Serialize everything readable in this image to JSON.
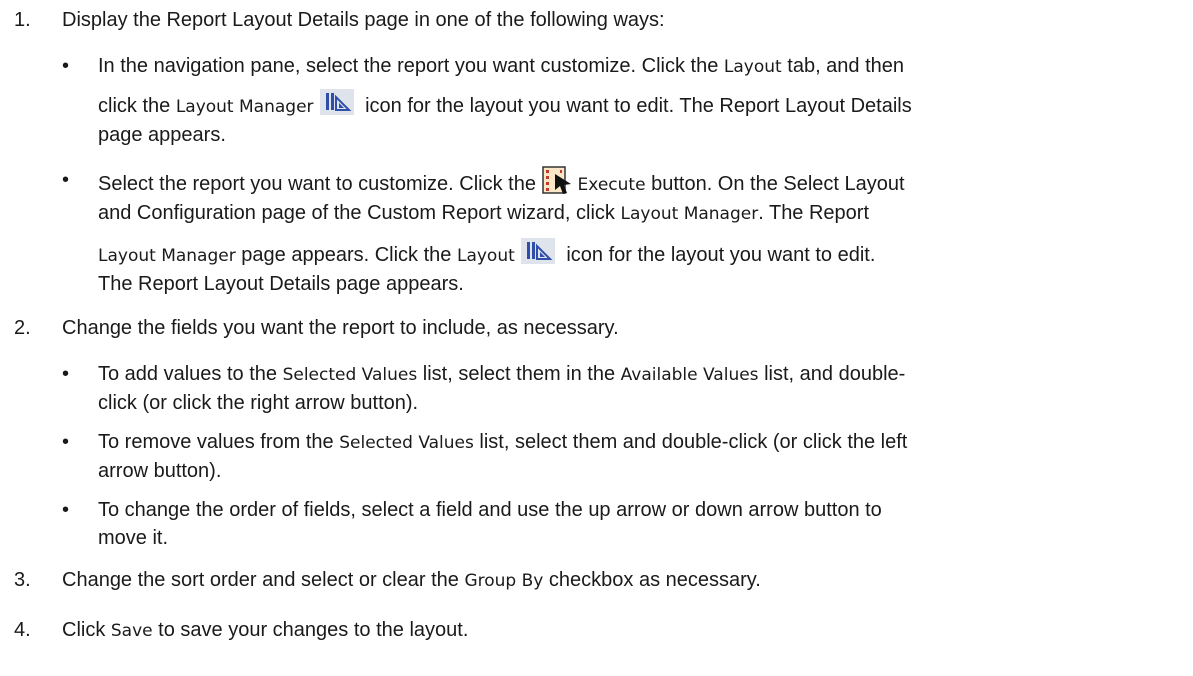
{
  "steps": [
    {
      "number": "1.",
      "text": "Display the Report Layout Details page in one of the following ways:",
      "bullets": [
        {
          "p1": "In the navigation pane, select the report you want customize. Click the ",
          "ui1": "Layout",
          "p2": " tab, and then",
          "p3": "click the ",
          "ui2": "Layout Manager",
          "icon": "layout-manager-icon",
          "p4": " icon for the layout you want to edit. The Report Layout Details",
          "p5": "page appears."
        },
        {
          "p1": "Select the report you want to customize. Click the ",
          "icon": "execute-icon",
          "ui1": "Execute",
          "p2": " button. On the Select Layout",
          "p3": "and Configuration page of the Custom Report wizard, click ",
          "ui2": "Layout Manager",
          "p4": ". The Report",
          "ui3": "Layout Manager",
          "p5": " page appears. Click the ",
          "ui4": "Layout",
          "icon2": "layout-icon",
          "p6": " icon for the layout you want to edit.",
          "p7": "The Report Layout Details page appears."
        }
      ]
    },
    {
      "number": "2.",
      "text": "Change the fields you want the report to include, as necessary.",
      "bullets": [
        {
          "p1": "To add values to the ",
          "ui1": "Selected Values",
          "p2": " list, select them in the ",
          "ui2": "Available Values",
          "p3": " list, and double-",
          "p4": "click (or click the right arrow button)."
        },
        {
          "p1": "To remove values from the ",
          "ui1": "Selected Values",
          "p2": " list, select them and double-click (or click the left",
          "p3": "arrow button)."
        },
        {
          "p1": "To change the order of fields, select a field and use the up arrow or down arrow button to",
          "p2": "move it."
        }
      ]
    },
    {
      "number": "3.",
      "p1": "Change the sort order and select or clear the ",
      "ui1": "Group By",
      "p2": " checkbox as necessary."
    },
    {
      "number": "4.",
      "p1": "Click ",
      "ui1": "Save",
      "p2": " to save your changes to the layout."
    }
  ],
  "bullet_glyph": "•",
  "colors": {
    "text": "#1a1a1a",
    "icon_blue": "#2f4ea8",
    "icon_red": "#c43a2a"
  }
}
